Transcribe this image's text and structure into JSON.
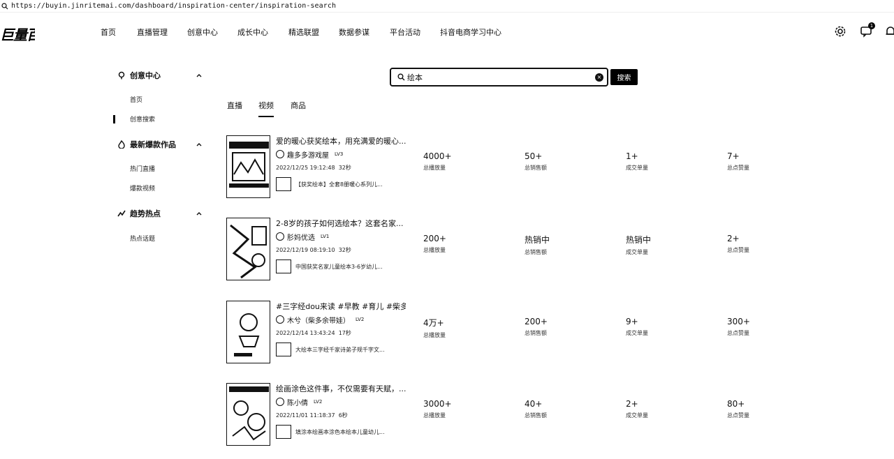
{
  "browser": {
    "url": "https://buyin.jinritemai.com/dashboard/inspiration-center/inspiration-search"
  },
  "header": {
    "logo": "巨量百应",
    "nav": [
      "首页",
      "直播管理",
      "创意中心",
      "成长中心",
      "精选联盟",
      "数据参谋",
      "平台活动",
      "抖音电商学习中心"
    ],
    "message_badge": "1",
    "icons": [
      "settings-icon",
      "message-icon",
      "bell-icon"
    ]
  },
  "sidebar": {
    "groups": [
      {
        "label": "创意中心",
        "icon": "bulb-icon",
        "items": [
          "首页",
          "创意搜索"
        ]
      },
      {
        "label": "最新爆款作品",
        "icon": "fire-icon",
        "items": [
          "热门直播",
          "爆款视频"
        ]
      },
      {
        "label": "趋势热点",
        "icon": "trend-icon",
        "items": [
          "热点话题"
        ]
      }
    ],
    "active_item": "创意搜索"
  },
  "search": {
    "value": "绘本",
    "button": "搜索"
  },
  "tabs": [
    "直播",
    "视频",
    "商品"
  ],
  "active_tab": "视频",
  "results": [
    {
      "title": "爱的暖心获奖绘本，用充满爱的暖心...",
      "author": "趣多多游戏屋",
      "level": "LV3",
      "datetime": "2022/12/25 19:12:48",
      "duration": "32秒",
      "product": "【获奖绘本】全套8册暖心系列儿...",
      "stats": [
        {
          "value": "4000+",
          "label": "总播放量"
        },
        {
          "value": "50+",
          "label": "总销售额"
        },
        {
          "value": "1+",
          "label": "成交单量"
        },
        {
          "value": "7+",
          "label": "总点赞量"
        }
      ]
    },
    {
      "title": "2-8岁的孩子如何选绘本？这套名家...",
      "author": "肜妈优选",
      "level": "LV1",
      "datetime": "2022/12/19 08:19:10",
      "duration": "32秒",
      "product": "中国获奖名家儿童绘本3-6岁幼儿...",
      "stats": [
        {
          "value": "200+",
          "label": "总播放量"
        },
        {
          "value": "热销中",
          "label": "总销售额"
        },
        {
          "value": "热销中",
          "label": "成交单量"
        },
        {
          "value": "2+",
          "label": "总点赞量"
        }
      ]
    },
    {
      "title": "#三字经dou来读 #早教 #育儿 #柴多...",
      "author": "木兮（柴多余带娃）",
      "level": "LV2",
      "datetime": "2022/12/14 13:43:24",
      "duration": "17秒",
      "product": "大绘本三字经千家诗弟子规千字文...",
      "stats": [
        {
          "value": "4万+",
          "label": "总播放量"
        },
        {
          "value": "200+",
          "label": "总销售额"
        },
        {
          "value": "9+",
          "label": "成交单量"
        },
        {
          "value": "300+",
          "label": "总点赞量"
        }
      ]
    },
    {
      "title": "绘画涂色这件事，不仅需要有天赋，...",
      "author": "陈小倩",
      "level": "LV2",
      "datetime": "2022/11/01 11:18:37",
      "duration": "6秒",
      "product": "填涂本绘画本涂色本绘本儿童幼儿...",
      "stats": [
        {
          "value": "3000+",
          "label": "总播放量"
        },
        {
          "value": "40+",
          "label": "总销售额"
        },
        {
          "value": "2+",
          "label": "成交单量"
        },
        {
          "value": "80+",
          "label": "总点赞量"
        }
      ]
    }
  ]
}
